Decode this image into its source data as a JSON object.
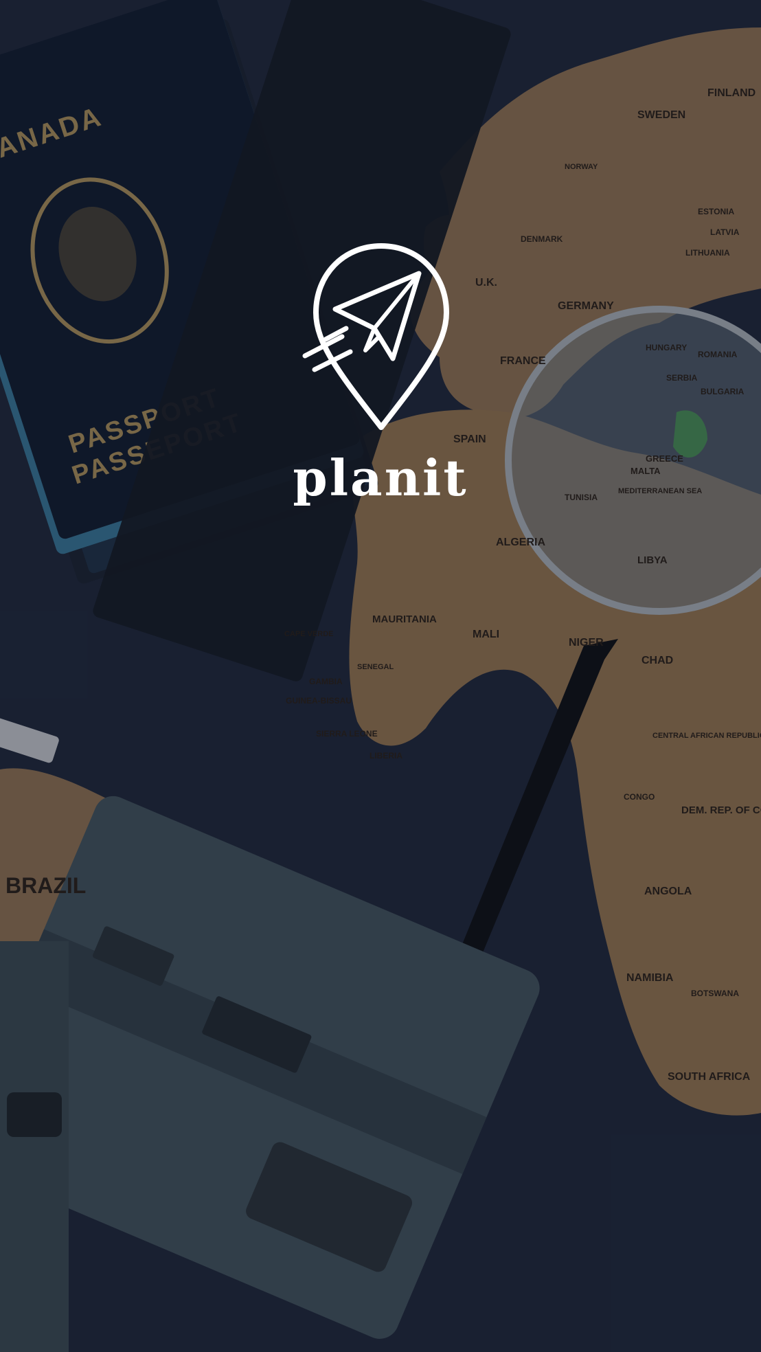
{
  "app": {
    "name": "planit"
  },
  "background": {
    "passport_country": "ANADA",
    "passport_line1": "PASSPORT",
    "passport_line2": "PASSEPORT",
    "map_labels": {
      "finland": "FINLAND",
      "sweden": "SWEDEN",
      "denmark": "DENMARK",
      "uk": "U.K.",
      "germany": "GERMANY",
      "france": "FRANCE",
      "spain": "SPAIN",
      "algeria": "ALGERIA",
      "mauritania": "MAURITANIA",
      "mali": "MALI",
      "niger": "NIGER",
      "chad": "CHAD",
      "senegal": "SENEGAL",
      "gambia": "GAMBIA",
      "guinea_bissau": "GUINEA-BISSAU",
      "sierra_leone": "SIERRA LEONE",
      "liberia": "LIBERIA",
      "cape_verde": "CAPE VERDE",
      "car": "CENTRAL AFRICAN REPUBLIC",
      "congo": "CONGO",
      "drc": "DEM. REP. OF CONGO",
      "angola": "ANGOLA",
      "namibia": "NAMIBIA",
      "botswana": "BOTSWANA",
      "south_africa": "SOUTH AFRICA",
      "brazil": "BRAZIL",
      "greece": "GREECE",
      "malta": "MALTA",
      "libya": "LIBYA",
      "hungary": "HUNGARY",
      "romania": "ROMANIA",
      "serbia": "SERBIA",
      "bulgaria": "BULGARIA",
      "estonia": "ESTONIA",
      "latvia": "LATVIA",
      "lithuania": "LITHUANIA",
      "norway": "NORWAY",
      "tunisia": "TUNISIA",
      "mediterranean": "MEDITERRANEAN SEA"
    }
  },
  "colors": {
    "overlay": "#10162680",
    "land": "#a7825a",
    "sea": "#1f273a",
    "logo": "#ffffff"
  }
}
